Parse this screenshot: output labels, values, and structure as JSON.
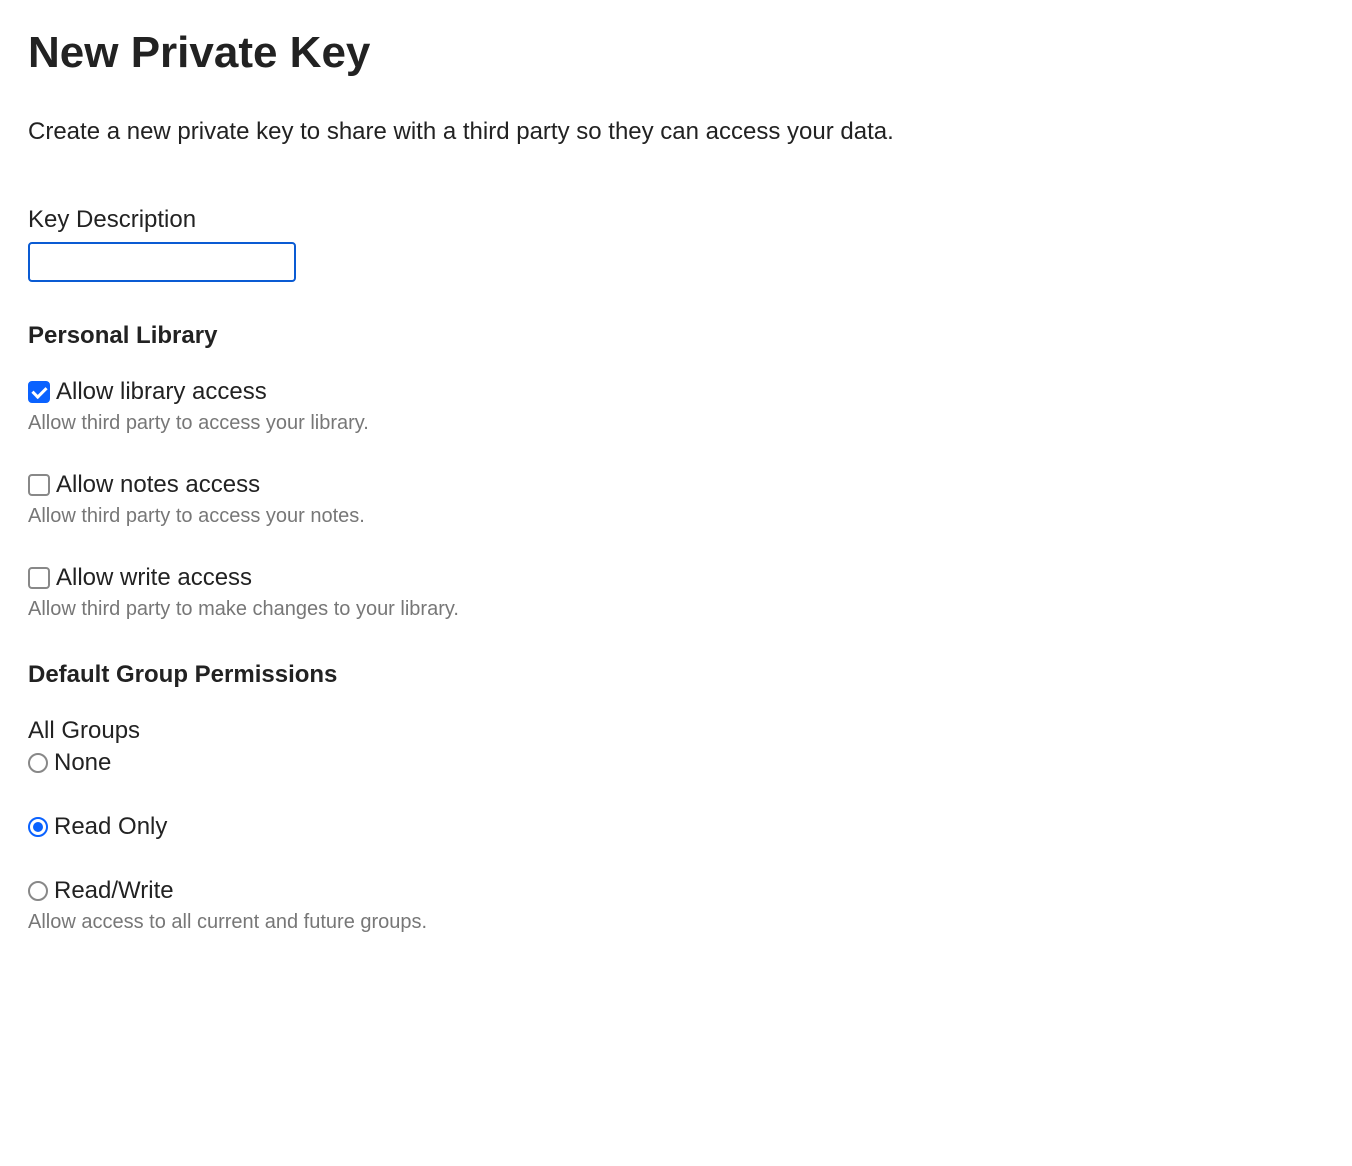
{
  "page": {
    "title": "New Private Key",
    "subtitle": "Create a new private key to share with a third party so they can access your data."
  },
  "key_description": {
    "label": "Key Description",
    "value": ""
  },
  "personal_library": {
    "heading": "Personal Library",
    "options": {
      "library_access": {
        "label": "Allow library access",
        "description": "Allow third party to access your library.",
        "checked": true
      },
      "notes_access": {
        "label": "Allow notes access",
        "description": "Allow third party to access your notes.",
        "checked": false
      },
      "write_access": {
        "label": "Allow write access",
        "description": "Allow third party to make changes to your library.",
        "checked": false
      }
    }
  },
  "group_permissions": {
    "heading": "Default Group Permissions",
    "all_groups_label": "All Groups",
    "options": {
      "none": {
        "label": "None",
        "selected": false
      },
      "read_only": {
        "label": "Read Only",
        "selected": true
      },
      "read_write": {
        "label": "Read/Write",
        "selected": false
      }
    },
    "footer_desc": "Allow access to all current and future groups."
  }
}
